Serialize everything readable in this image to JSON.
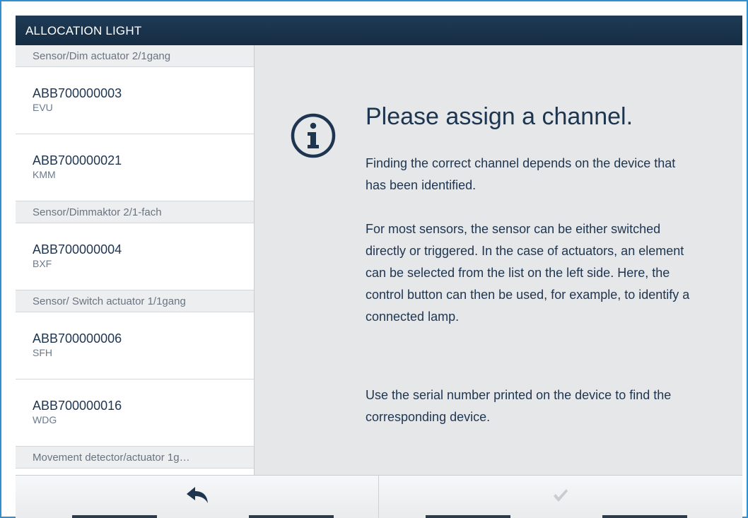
{
  "window": {
    "title": "ALLOCATION LIGHT"
  },
  "sidebar": {
    "groups": [
      {
        "header": "Sensor/Dim actuator 2/1gang",
        "devices": [
          {
            "id": "ABB700000003",
            "code": "EVU"
          },
          {
            "id": "ABB700000021",
            "code": "KMM"
          }
        ]
      },
      {
        "header": "Sensor/Dimmaktor 2/1-fach",
        "devices": [
          {
            "id": "ABB700000004",
            "code": "BXF"
          }
        ]
      },
      {
        "header": "Sensor/ Switch actuator 1/1gang",
        "devices": [
          {
            "id": "ABB700000006",
            "code": "SFH"
          },
          {
            "id": "ABB700000016",
            "code": "WDG"
          }
        ]
      },
      {
        "header": "Movement detector/actuator 1g…",
        "devices": []
      }
    ]
  },
  "content": {
    "icon": "info-icon",
    "title": "Please assign a channel.",
    "paragraphs": [
      "Finding the correct channel depends on the device that has been identified.",
      "For most sensors, the sensor can be either switched directly or triggered. In the case of actuators, an element can be selected from the list on the left side. Here, the control button can then be used, for example, to identify a connected lamp.",
      "Use the serial number printed on the device to find the corresponding device."
    ]
  },
  "footer": {
    "back_icon": "back-arrow-icon",
    "confirm_icon": "checkmark-icon"
  },
  "colors": {
    "titlebar": "#1a3550",
    "text_dark": "#1e3550",
    "frame_border": "#2f8fd1",
    "content_bg": "#e6e7e9"
  }
}
